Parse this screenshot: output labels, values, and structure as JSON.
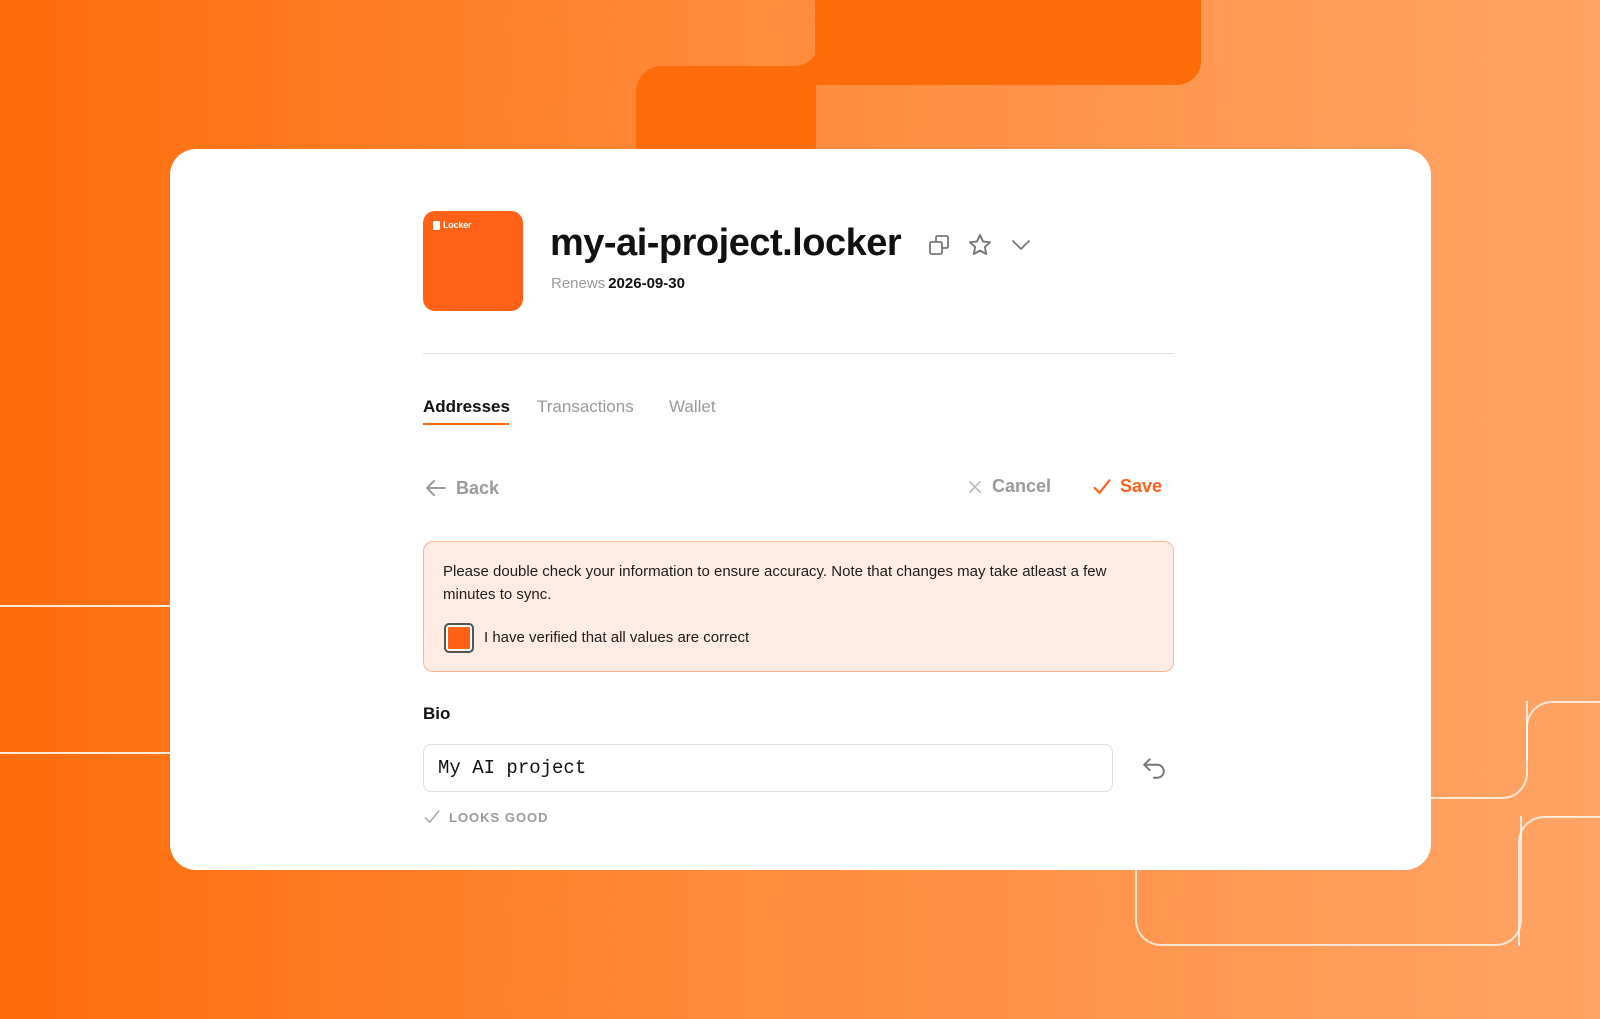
{
  "logo": {
    "brand": "Locker"
  },
  "header": {
    "title": "my-ai-project.locker",
    "renews_label": "Renews",
    "renews_date": "2026-09-30"
  },
  "tabs": [
    {
      "label": "Addresses",
      "active": true
    },
    {
      "label": "Transactions",
      "active": false
    },
    {
      "label": "Wallet",
      "active": false
    }
  ],
  "actions": {
    "back_label": "Back",
    "cancel_label": "Cancel",
    "save_label": "Save"
  },
  "notice": {
    "text": "Please double check your information to ensure accuracy. Note that changes may take atleast a few minutes to sync.",
    "checkbox_label": "I have verified that all values are correct",
    "checked": true
  },
  "bio": {
    "label": "Bio",
    "value": "My AI project",
    "validation": "LOOKS GOOD"
  },
  "colors": {
    "accent": "#ff6117",
    "background": "#ff6c0a",
    "notice_bg": "#ffede5",
    "notice_border": "#ffb48e",
    "muted_text": "#9a9a9a"
  },
  "icons": [
    "copy-icon",
    "star-icon",
    "chevron-down-icon",
    "arrow-left-icon",
    "close-icon",
    "check-icon",
    "undo-icon"
  ]
}
